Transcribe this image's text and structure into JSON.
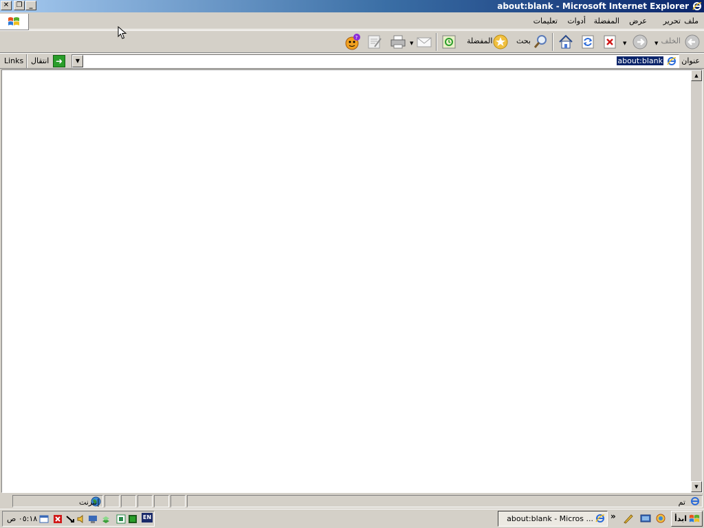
{
  "window": {
    "title": "about:blank - Microsoft Internet Explorer",
    "controls": [
      "close",
      "restore",
      "minimize"
    ]
  },
  "menubar": {
    "items": [
      "ملف",
      "تحرير",
      "عرض",
      "المفضلة",
      "أدوات",
      "تعليمات"
    ]
  },
  "toolbar": {
    "back_label": "الخلف",
    "search_label": "بحث",
    "favorites_label": "المفضلة"
  },
  "address": {
    "label": "عنوان",
    "value": "about:blank",
    "go_label": "انتقال",
    "links_label": "Links"
  },
  "statusbar": {
    "status": "تم",
    "zone": "إنترنت"
  },
  "taskbar": {
    "start_label": "ابدأ",
    "task_label": "about:blank - Micros ...",
    "clock": "٠٥:١٨ ص",
    "lang": "EN"
  },
  "colors": {
    "title_dark": "#0a246a",
    "title_light": "#a6caf0",
    "chrome": "#d4d0c8"
  }
}
